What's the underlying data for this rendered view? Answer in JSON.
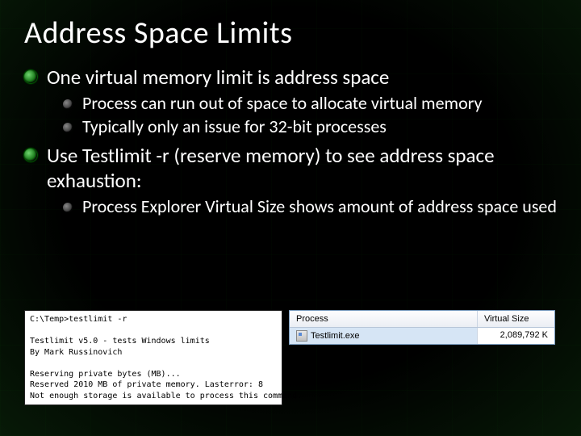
{
  "slide": {
    "title": "Address Space Limits",
    "bullets": [
      {
        "text": "One virtual memory limit is address space",
        "sub": [
          "Process can run out of space to allocate virtual memory",
          "Typically only an issue for 32-bit processes"
        ]
      },
      {
        "text": "Use Testlimit -r (reserve memory) to see address space exhaustion:",
        "sub": [
          "Process Explorer Virtual Size shows amount of address space used"
        ]
      }
    ]
  },
  "console": {
    "text": "C:\\Temp>testlimit -r\n\nTestlimit v5.0 - tests Windows limits\nBy Mark Russinovich\n\nReserving private bytes (MB)...\nReserved 2010 MB of private memory. Lasterror: 8\nNot enough storage is available to process this command."
  },
  "pe": {
    "headers": {
      "process": "Process",
      "vsize": "Virtual Size"
    },
    "row": {
      "name": "Testlimit.exe",
      "vsize": "2,089,792 K"
    }
  }
}
